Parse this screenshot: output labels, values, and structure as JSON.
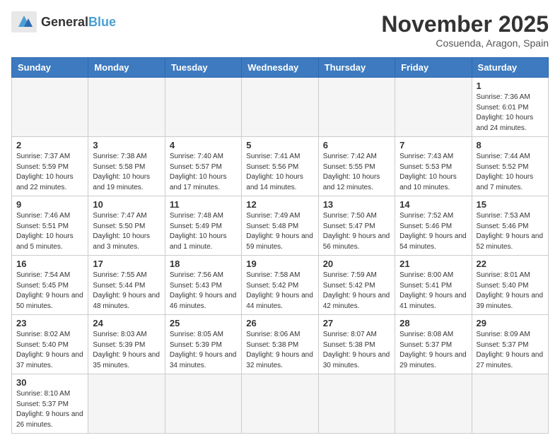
{
  "logo": {
    "text_general": "General",
    "text_blue": "Blue"
  },
  "header": {
    "month_year": "November 2025",
    "location": "Cosuenda, Aragon, Spain"
  },
  "weekdays": [
    "Sunday",
    "Monday",
    "Tuesday",
    "Wednesday",
    "Thursday",
    "Friday",
    "Saturday"
  ],
  "days": [
    {
      "num": "",
      "info": ""
    },
    {
      "num": "",
      "info": ""
    },
    {
      "num": "",
      "info": ""
    },
    {
      "num": "",
      "info": ""
    },
    {
      "num": "",
      "info": ""
    },
    {
      "num": "",
      "info": ""
    },
    {
      "num": "1",
      "info": "Sunrise: 7:36 AM\nSunset: 6:01 PM\nDaylight: 10 hours and 24 minutes."
    },
    {
      "num": "2",
      "info": "Sunrise: 7:37 AM\nSunset: 5:59 PM\nDaylight: 10 hours and 22 minutes."
    },
    {
      "num": "3",
      "info": "Sunrise: 7:38 AM\nSunset: 5:58 PM\nDaylight: 10 hours and 19 minutes."
    },
    {
      "num": "4",
      "info": "Sunrise: 7:40 AM\nSunset: 5:57 PM\nDaylight: 10 hours and 17 minutes."
    },
    {
      "num": "5",
      "info": "Sunrise: 7:41 AM\nSunset: 5:56 PM\nDaylight: 10 hours and 14 minutes."
    },
    {
      "num": "6",
      "info": "Sunrise: 7:42 AM\nSunset: 5:55 PM\nDaylight: 10 hours and 12 minutes."
    },
    {
      "num": "7",
      "info": "Sunrise: 7:43 AM\nSunset: 5:53 PM\nDaylight: 10 hours and 10 minutes."
    },
    {
      "num": "8",
      "info": "Sunrise: 7:44 AM\nSunset: 5:52 PM\nDaylight: 10 hours and 7 minutes."
    },
    {
      "num": "9",
      "info": "Sunrise: 7:46 AM\nSunset: 5:51 PM\nDaylight: 10 hours and 5 minutes."
    },
    {
      "num": "10",
      "info": "Sunrise: 7:47 AM\nSunset: 5:50 PM\nDaylight: 10 hours and 3 minutes."
    },
    {
      "num": "11",
      "info": "Sunrise: 7:48 AM\nSunset: 5:49 PM\nDaylight: 10 hours and 1 minute."
    },
    {
      "num": "12",
      "info": "Sunrise: 7:49 AM\nSunset: 5:48 PM\nDaylight: 9 hours and 59 minutes."
    },
    {
      "num": "13",
      "info": "Sunrise: 7:50 AM\nSunset: 5:47 PM\nDaylight: 9 hours and 56 minutes."
    },
    {
      "num": "14",
      "info": "Sunrise: 7:52 AM\nSunset: 5:46 PM\nDaylight: 9 hours and 54 minutes."
    },
    {
      "num": "15",
      "info": "Sunrise: 7:53 AM\nSunset: 5:46 PM\nDaylight: 9 hours and 52 minutes."
    },
    {
      "num": "16",
      "info": "Sunrise: 7:54 AM\nSunset: 5:45 PM\nDaylight: 9 hours and 50 minutes."
    },
    {
      "num": "17",
      "info": "Sunrise: 7:55 AM\nSunset: 5:44 PM\nDaylight: 9 hours and 48 minutes."
    },
    {
      "num": "18",
      "info": "Sunrise: 7:56 AM\nSunset: 5:43 PM\nDaylight: 9 hours and 46 minutes."
    },
    {
      "num": "19",
      "info": "Sunrise: 7:58 AM\nSunset: 5:42 PM\nDaylight: 9 hours and 44 minutes."
    },
    {
      "num": "20",
      "info": "Sunrise: 7:59 AM\nSunset: 5:42 PM\nDaylight: 9 hours and 42 minutes."
    },
    {
      "num": "21",
      "info": "Sunrise: 8:00 AM\nSunset: 5:41 PM\nDaylight: 9 hours and 41 minutes."
    },
    {
      "num": "22",
      "info": "Sunrise: 8:01 AM\nSunset: 5:40 PM\nDaylight: 9 hours and 39 minutes."
    },
    {
      "num": "23",
      "info": "Sunrise: 8:02 AM\nSunset: 5:40 PM\nDaylight: 9 hours and 37 minutes."
    },
    {
      "num": "24",
      "info": "Sunrise: 8:03 AM\nSunset: 5:39 PM\nDaylight: 9 hours and 35 minutes."
    },
    {
      "num": "25",
      "info": "Sunrise: 8:05 AM\nSunset: 5:39 PM\nDaylight: 9 hours and 34 minutes."
    },
    {
      "num": "26",
      "info": "Sunrise: 8:06 AM\nSunset: 5:38 PM\nDaylight: 9 hours and 32 minutes."
    },
    {
      "num": "27",
      "info": "Sunrise: 8:07 AM\nSunset: 5:38 PM\nDaylight: 9 hours and 30 minutes."
    },
    {
      "num": "28",
      "info": "Sunrise: 8:08 AM\nSunset: 5:37 PM\nDaylight: 9 hours and 29 minutes."
    },
    {
      "num": "29",
      "info": "Sunrise: 8:09 AM\nSunset: 5:37 PM\nDaylight: 9 hours and 27 minutes."
    },
    {
      "num": "30",
      "info": "Sunrise: 8:10 AM\nSunset: 5:37 PM\nDaylight: 9 hours and 26 minutes."
    },
    {
      "num": "",
      "info": ""
    },
    {
      "num": "",
      "info": ""
    },
    {
      "num": "",
      "info": ""
    },
    {
      "num": "",
      "info": ""
    },
    {
      "num": "",
      "info": ""
    },
    {
      "num": "",
      "info": ""
    }
  ]
}
